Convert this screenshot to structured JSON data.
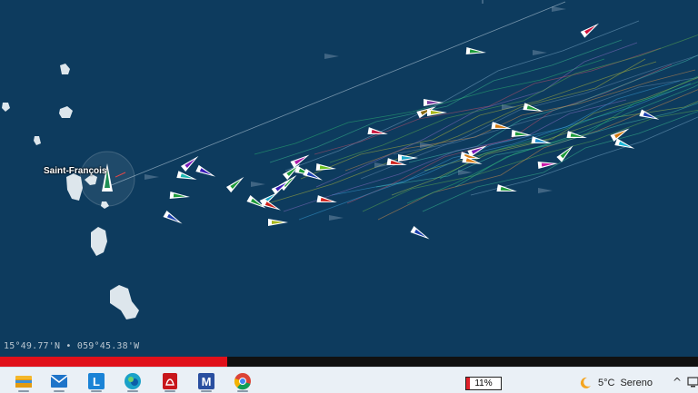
{
  "map": {
    "place_label": "Saint-François",
    "coordinates": "15°49.77'N • 059°45.38'W",
    "colors": {
      "sea": "#0d3b5e",
      "land": "#dde6ec",
      "selected_boat": "#1f8f55"
    }
  },
  "race_progress": {
    "fraction": 0.325,
    "color": "#e0101a"
  },
  "taskbar": {
    "apps": [
      {
        "name": "file-explorer-icon",
        "color": "#f3b72b"
      },
      {
        "name": "mail-icon",
        "color": "#1e74c9"
      },
      {
        "name": "l-app-icon",
        "color": "#1a83d6",
        "glyph": "L"
      },
      {
        "name": "edge-icon",
        "color": "#1aa1c8"
      },
      {
        "name": "pdf-reader-icon",
        "color": "#c8171c"
      },
      {
        "name": "m-app-icon",
        "color": "#2a4fa0",
        "glyph": "M"
      },
      {
        "name": "chrome-icon",
        "color": "#db4437"
      }
    ],
    "battery_label": "11%",
    "battery_level": 0.11,
    "weather_temp": "5°C",
    "weather_desc": "Sereno"
  }
}
